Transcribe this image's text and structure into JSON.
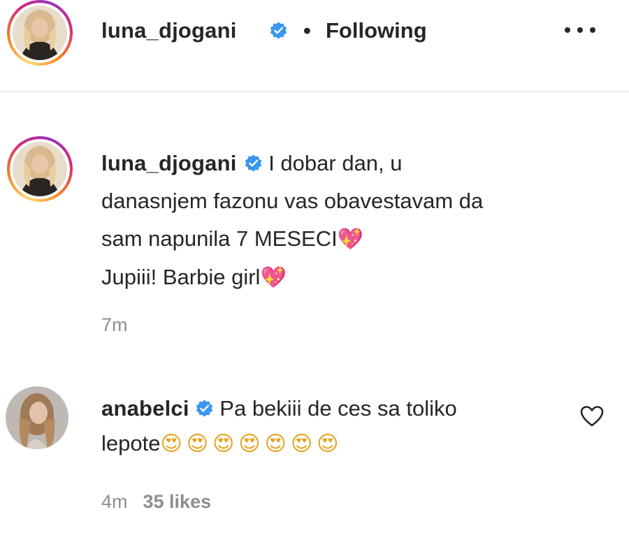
{
  "header": {
    "username": "luna_djogani",
    "verified_icon": "verified-badge-icon",
    "separator": "•",
    "follow_status": "Following",
    "more_icon": "more-options-icon"
  },
  "caption": {
    "username": "luna_djogani",
    "text_line1": "I dobar dan, u",
    "text_line2": "danasnjem fazonu vas obavestavam da",
    "text_line3": "sam napunila 7 MESECI",
    "text_line4": "Jupiii! Barbie girl",
    "emoji": "💖",
    "time": "7m"
  },
  "comment": {
    "username": "anabelci",
    "text_line1": "Pa bekiii de ces sa toliko",
    "text_line2": "lepote",
    "emoji_row": "😍😍😍😍😍😍😍",
    "time": "4m",
    "likes": "35 likes",
    "like_icon": "heart-outline-icon"
  },
  "colors": {
    "text": "#262626",
    "muted": "#8e8e8e",
    "verified": "#3897f0",
    "divider": "#efefef"
  }
}
